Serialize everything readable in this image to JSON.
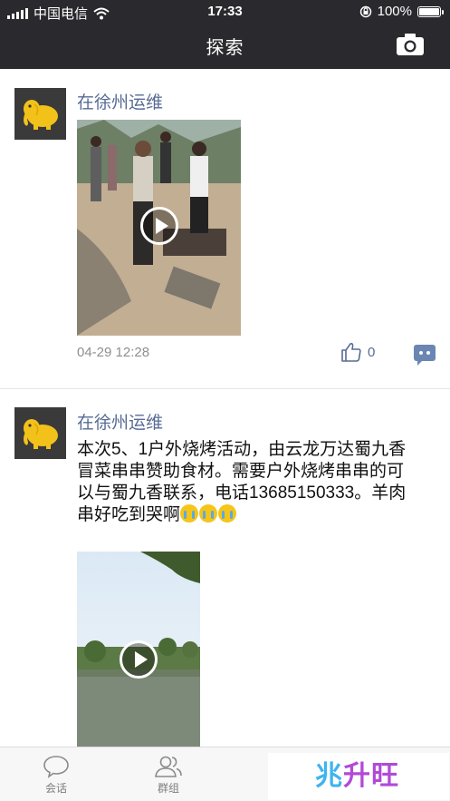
{
  "status_bar": {
    "carrier": "中国电信",
    "time": "17:33",
    "battery": "100%",
    "battery_level": 1.0
  },
  "nav": {
    "title": "探索",
    "camera_icon": "camera-icon"
  },
  "posts": [
    {
      "author": "在徐州运维",
      "time": "04-29 12:28",
      "likes": "0"
    },
    {
      "author": "在徐州运维",
      "text": "本次5、1户外烧烤活动，由云龙万达蜀九香冒菜串串赞助食材。需要户外烧烤串串的可以与蜀九香联系，电话13685150333。羊肉串好吃到哭啊"
    }
  ],
  "tabs": [
    {
      "label": "会话",
      "icon": "chat-bubble-icon"
    },
    {
      "label": "群组",
      "icon": "group-icon"
    }
  ],
  "watermark": {
    "text_a": "兆",
    "text_b": "升旺"
  }
}
